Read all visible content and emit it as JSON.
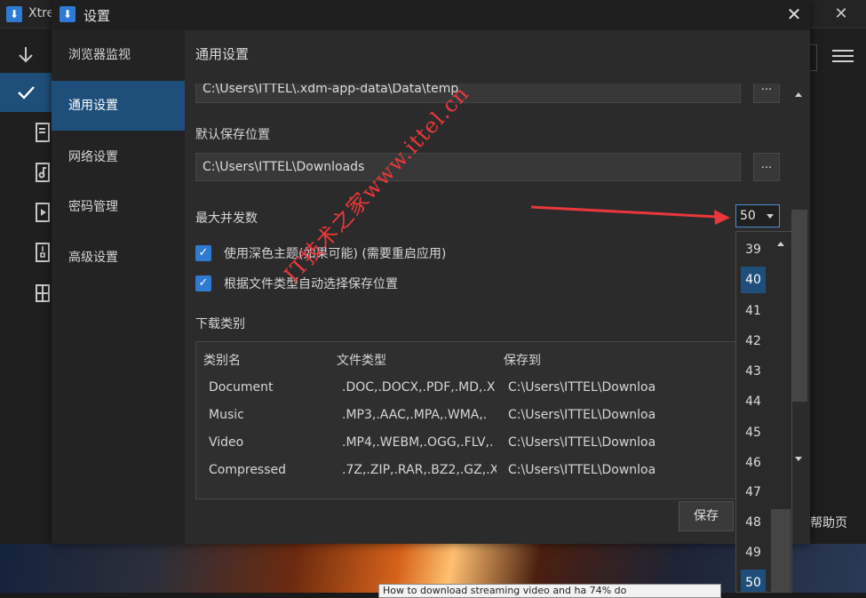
{
  "background_app": {
    "title": "Xtre",
    "help_label": "帮助页",
    "tooltip": "How to download streaming video and ha 74% do"
  },
  "dialog": {
    "title": "设置",
    "nav": [
      {
        "label": "浏览器监视"
      },
      {
        "label": "通用设置"
      },
      {
        "label": "网络设置"
      },
      {
        "label": "密码管理"
      },
      {
        "label": "高级设置"
      }
    ],
    "section_title": "通用设置",
    "temp_path": "C:\\Users\\ITTEL\\.xdm-app-data\\Data\\temp",
    "browse_label": "...",
    "default_save_label": "默认保存位置",
    "default_save_path": "C:\\Users\\ITTEL\\Downloads",
    "max_concurrent_label": "最大并发数",
    "max_concurrent_value": "50",
    "checkbox_dark_theme": "使用深色主题(如果可能) (需要重启应用)",
    "checkbox_auto_location": "根据文件类型自动选择保存位置",
    "categories_label": "下载类别",
    "table": {
      "headers": [
        "类别名",
        "文件类型",
        "保存到"
      ],
      "rows": [
        [
          "Document",
          ".DOC,.DOCX,.PDF,.MD,.X",
          "C:\\Users\\ITTEL\\Downloa"
        ],
        [
          "Music",
          ".MP3,.AAC,.MPA,.WMA,.",
          "C:\\Users\\ITTEL\\Downloa"
        ],
        [
          "Video",
          ".MP4,.WEBM,.OGG,.FLV,.",
          "C:\\Users\\ITTEL\\Downloa"
        ],
        [
          "Compressed",
          ".7Z,.ZIP,.RAR,.BZ2,.GZ,.X",
          "C:\\Users\\ITTEL\\Downloa"
        ]
      ]
    },
    "save_button": "保存"
  },
  "dropdown": {
    "options": [
      "39",
      "40",
      "41",
      "42",
      "43",
      "44",
      "45",
      "46",
      "47",
      "48",
      "49",
      "50"
    ],
    "hovered": "40",
    "selected": "50"
  },
  "watermark": "IT技术之家www.ittel.cn",
  "colors": {
    "accent": "#1e4f7a",
    "checkbox": "#2f7bd2",
    "watermark": "#e8383a"
  }
}
